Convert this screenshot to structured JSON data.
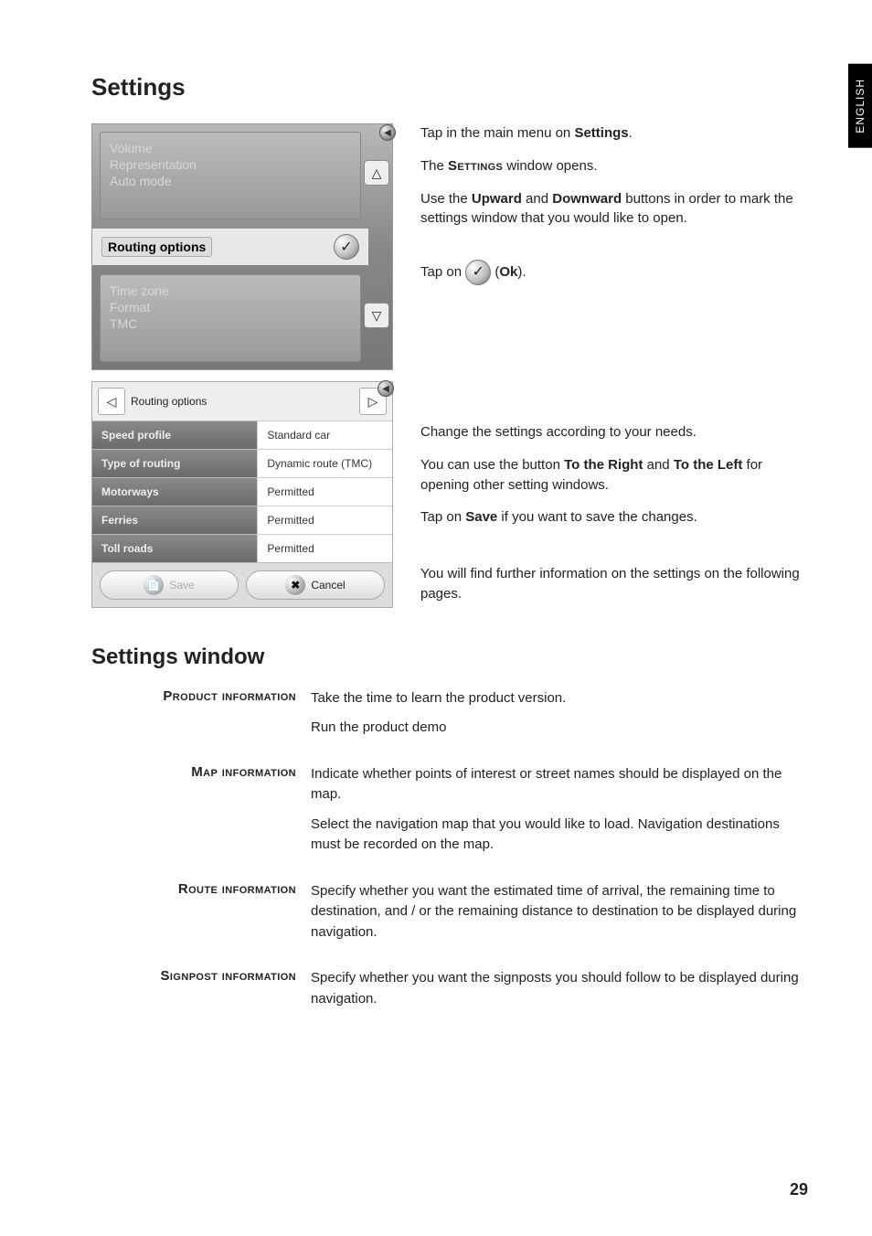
{
  "language_tab": "ENGLISH",
  "h1": "Settings",
  "h2": "Settings window",
  "intro": {
    "p1a": "Tap in the main menu on ",
    "p1b": "Settings",
    "p1c": ".",
    "p2a": "The ",
    "p2b": "Settings",
    "p2c": " window opens.",
    "p3a": "Use the ",
    "p3b": "Upward",
    "p3c": " and ",
    "p3d": "Downward",
    "p3e": " buttons in order to mark the settings window that you would like to open.",
    "p4a": "Tap on ",
    "p4b": " (",
    "p4c": "Ok",
    "p4d": ")."
  },
  "mid": {
    "p1": "Change the settings according to your needs.",
    "p2a": "You can use the button ",
    "p2b": "To the Right",
    "p2c": " and ",
    "p2d": "To the Left",
    "p2e": " for opening other setting windows.",
    "p3a": "Tap on ",
    "p3b": "Save",
    "p3c": " if you want to save the changes.",
    "p4": "You will find further information on the settings on the following pages."
  },
  "screen1": {
    "dim1": "Volume",
    "dim2": "Representation",
    "dim3": "Auto mode",
    "selected": "Routing options",
    "dim4": "Time zone",
    "dim5": "Format",
    "dim6": "TMC"
  },
  "screen2": {
    "title": "Routing options",
    "rows": [
      {
        "label": "Speed profile",
        "value": "Standard car"
      },
      {
        "label": "Type of routing",
        "value": "Dynamic route (TMC)"
      },
      {
        "label": "Motorways",
        "value": "Permitted"
      },
      {
        "label": "Ferries",
        "value": "Permitted"
      },
      {
        "label": "Toll roads",
        "value": "Permitted"
      }
    ],
    "save": "Save",
    "cancel": "Cancel"
  },
  "defs": [
    {
      "term": "Product information",
      "paras": [
        "Take the time to learn the product version.",
        "Run the product demo"
      ]
    },
    {
      "term": "Map information",
      "paras": [
        "Indicate whether points of interest or street names should be displayed on the map.",
        "Select the navigation map that you would like to load. Navigation destinations must be recorded on the map."
      ]
    },
    {
      "term": "Route information",
      "paras": [
        "Specify whether you want the estimated time of arrival, the remaining time to destination, and / or the remaining distance to destination to be displayed during navigation."
      ]
    },
    {
      "term": "Signpost information",
      "paras": [
        "Specify whether you want the signposts you should follow to be displayed during navigation."
      ]
    }
  ],
  "page_number": "29"
}
